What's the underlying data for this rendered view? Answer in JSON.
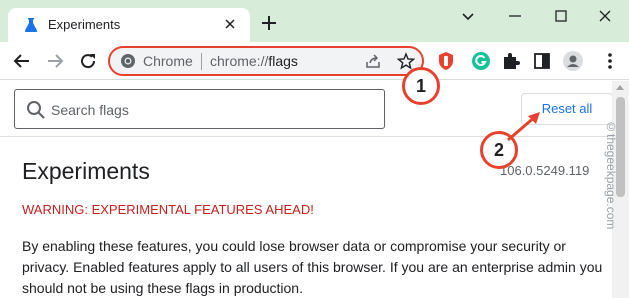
{
  "tab": {
    "title": "Experiments"
  },
  "omnibox": {
    "site": "Chrome",
    "url_scheme": "chrome://",
    "url_host": "flags"
  },
  "search": {
    "placeholder": "Search flags",
    "value": ""
  },
  "reset_button": {
    "label": "Reset all"
  },
  "content": {
    "title": "Experiments",
    "version": "106.0.5249.119",
    "warning": "WARNING: EXPERIMENTAL FEATURES AHEAD!",
    "description": "By enabling these features, you could lose browser data or compromise your security or privacy. Enabled features apply to all users of this browser. If you are an enterprise admin you should not be using these flags in production."
  },
  "annotations": {
    "one": "1",
    "two": "2"
  },
  "watermark": "©thegeekpage.com",
  "colors": {
    "tabstrip": "#d7ecd9",
    "accent": "#1a73e8",
    "warning": "#c5221f",
    "annotation": "#e8422f"
  },
  "icons": [
    "flask-icon",
    "close-icon",
    "plus-icon",
    "chevron-down-icon",
    "minimize-icon",
    "maximize-icon",
    "close-window-icon",
    "back-arrow-icon",
    "forward-arrow-icon",
    "reload-icon",
    "chrome-icon",
    "share-icon",
    "star-icon",
    "shield-extension-icon",
    "grammarly-icon",
    "puzzle-icon",
    "side-panel-icon",
    "profile-icon",
    "kebab-menu-icon",
    "search-icon"
  ]
}
